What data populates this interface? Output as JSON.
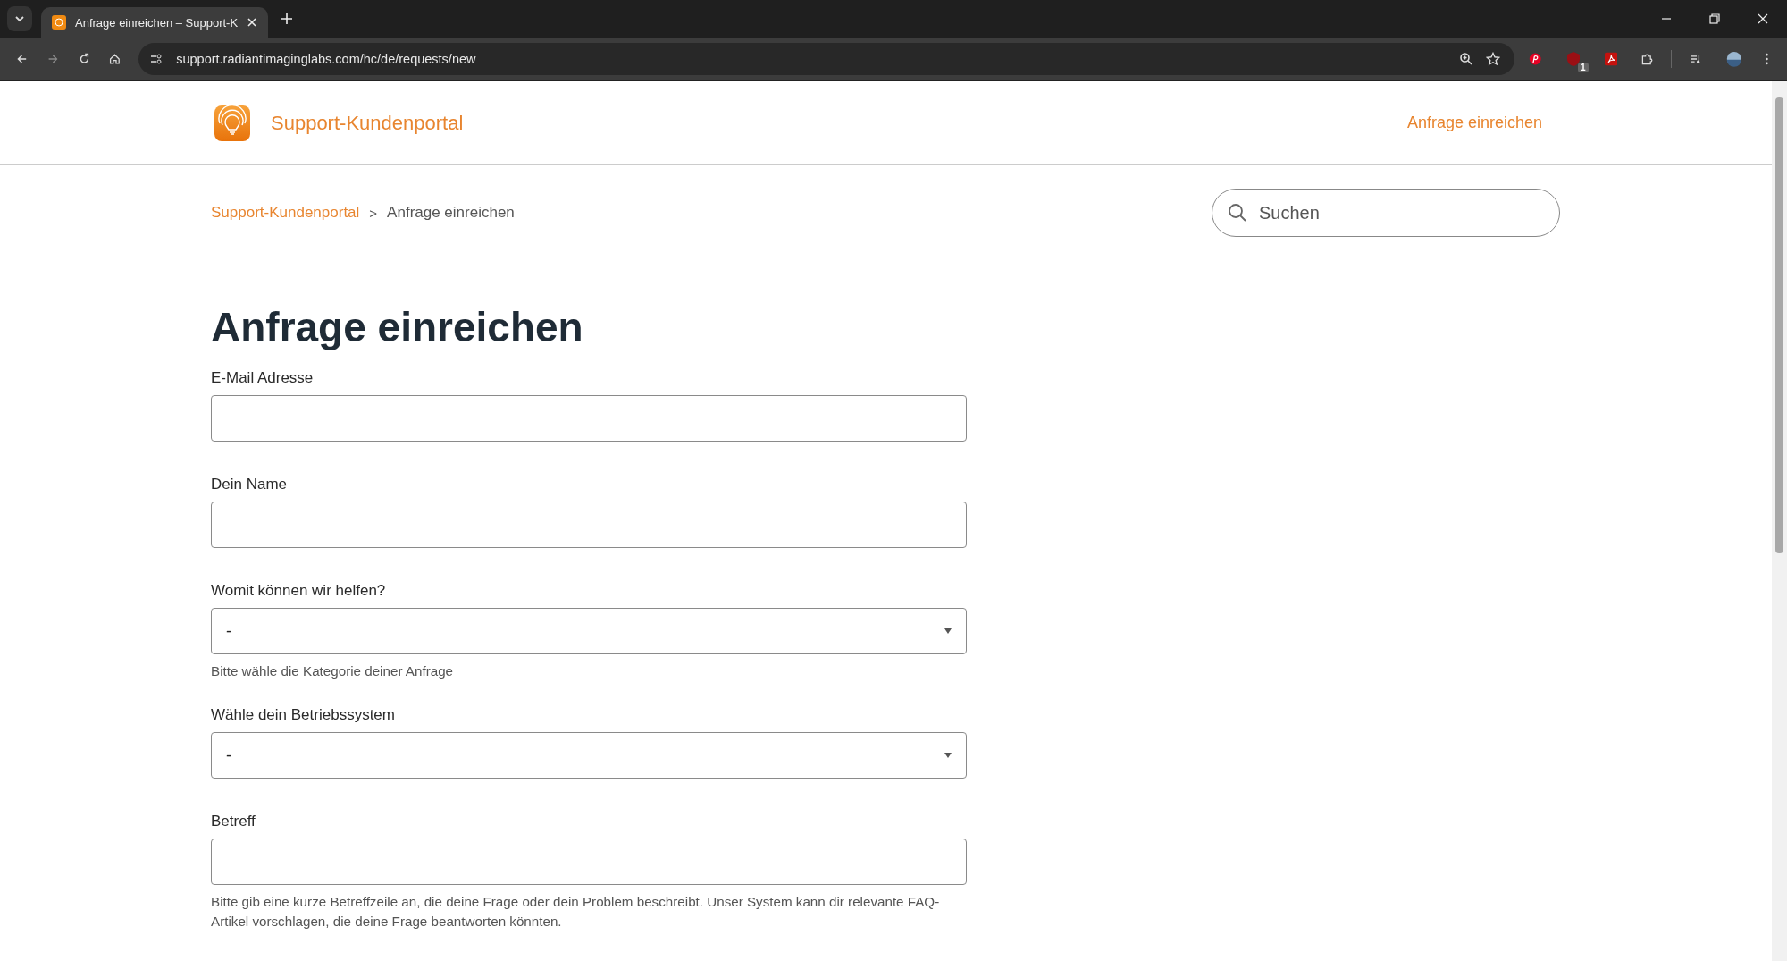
{
  "browser": {
    "tab": {
      "title": "Anfrage einreichen – Support-K",
      "selected": true
    },
    "url": "support.radiantimaginglabs.com/hc/de/requests/new",
    "extension_badge": "1"
  },
  "header": {
    "brand": "Support-Kundenportal",
    "nav_link": "Anfrage einreichen"
  },
  "breadcrumb": [
    {
      "label": "Support-Kundenportal",
      "kind": "link"
    },
    {
      "label": ">",
      "kind": "separator"
    },
    {
      "label": "Anfrage einreichen",
      "kind": "current"
    }
  ],
  "search": {
    "placeholder": "Suchen"
  },
  "heading": "Anfrage einreichen",
  "fields": [
    {
      "kind": "text",
      "label": "E-Mail Adresse"
    },
    {
      "kind": "text",
      "label": "Dein Name"
    },
    {
      "kind": "select",
      "label": "Womit können wir helfen?",
      "value": "-",
      "hint": "Bitte wähle die Kategorie deiner Anfrage"
    },
    {
      "kind": "select",
      "label": "Wähle dein Betriebssystem",
      "value": "-"
    },
    {
      "kind": "text",
      "label": "Betreff",
      "hint": "Bitte gib eine kurze Betreffzeile an, die deine Frage oder dein Problem beschreibt. Unser System kann dir relevante FAQ-Artikel vorschlagen, die deine Frage beantworten könnten."
    }
  ]
}
